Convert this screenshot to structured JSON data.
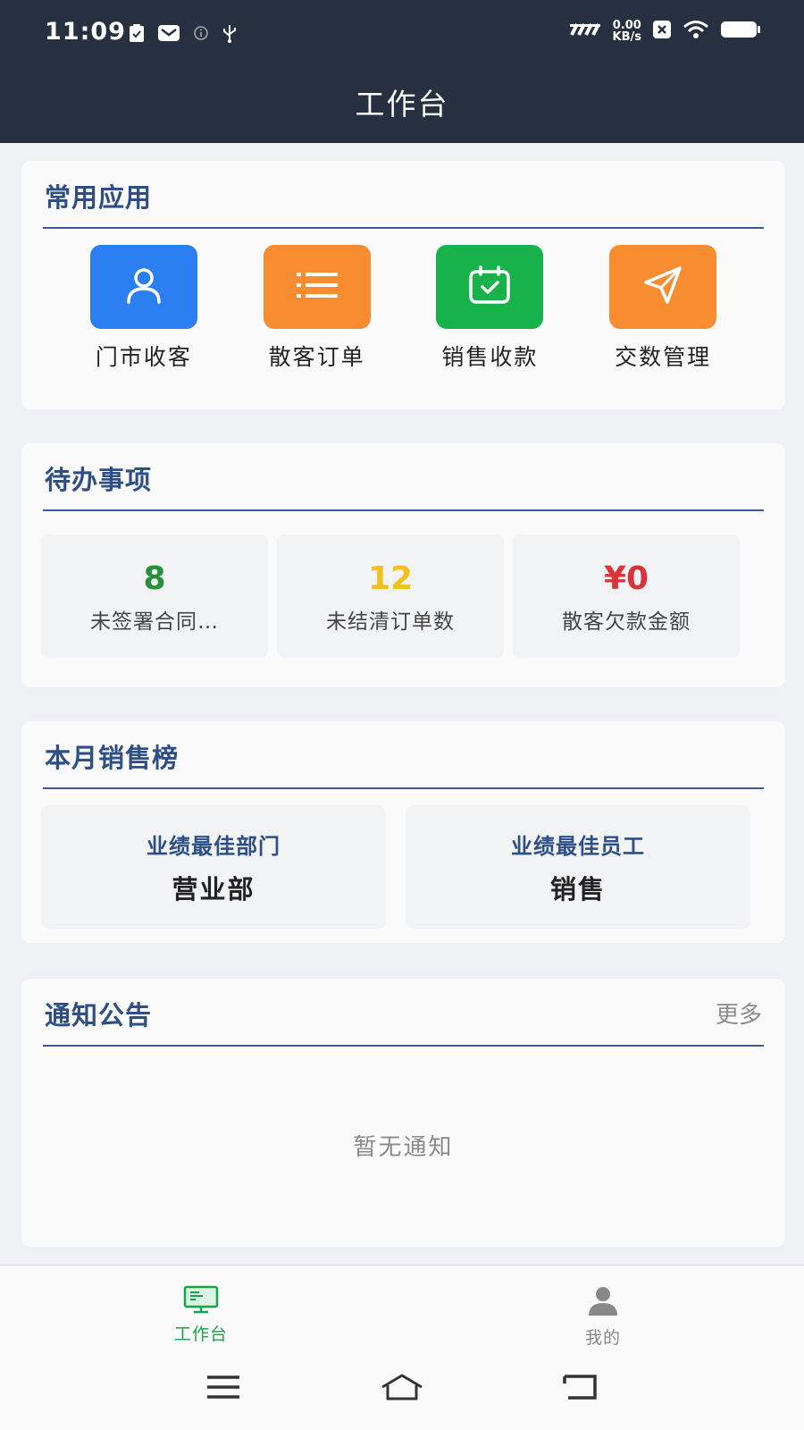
{
  "status_bar": {
    "time": "11:09",
    "speed_value": "0.00",
    "speed_unit": "KB/s"
  },
  "header": {
    "title": "工作台"
  },
  "common_apps": {
    "title": "常用应用",
    "items": [
      {
        "label": "门市收客",
        "icon": "user-icon",
        "color": "#2b7ff0"
      },
      {
        "label": "散客订单",
        "icon": "list-icon",
        "color": "#f78c30"
      },
      {
        "label": "销售收款",
        "icon": "calendar-check-icon",
        "color": "#17b34a"
      },
      {
        "label": "交数管理",
        "icon": "send-icon",
        "color": "#f78c30"
      }
    ]
  },
  "todo": {
    "title": "待办事项",
    "items": [
      {
        "value": "8",
        "label": "未签署合同…",
        "color": "#23923a"
      },
      {
        "value": "12",
        "label": "未结清订单数",
        "color": "#f2c01a"
      },
      {
        "value": "¥0",
        "label": "散客欠款金额",
        "color": "#d8343a"
      }
    ]
  },
  "sales_rank": {
    "title": "本月销售榜",
    "items": [
      {
        "label": "业绩最佳部门",
        "value": "营业部"
      },
      {
        "label": "业绩最佳员工",
        "value": "销售"
      }
    ]
  },
  "notices": {
    "title": "通知公告",
    "more_label": "更多",
    "empty_text": "暂无通知"
  },
  "tabbar": {
    "tabs": [
      {
        "label": "工作台",
        "icon": "monitor-icon",
        "active": true,
        "color": "#16a34a"
      },
      {
        "label": "我的",
        "icon": "person-icon",
        "active": false,
        "color": "#888888"
      }
    ]
  },
  "colors": {
    "header_bg": "#263041",
    "accent_blue": "#2d4f86"
  }
}
